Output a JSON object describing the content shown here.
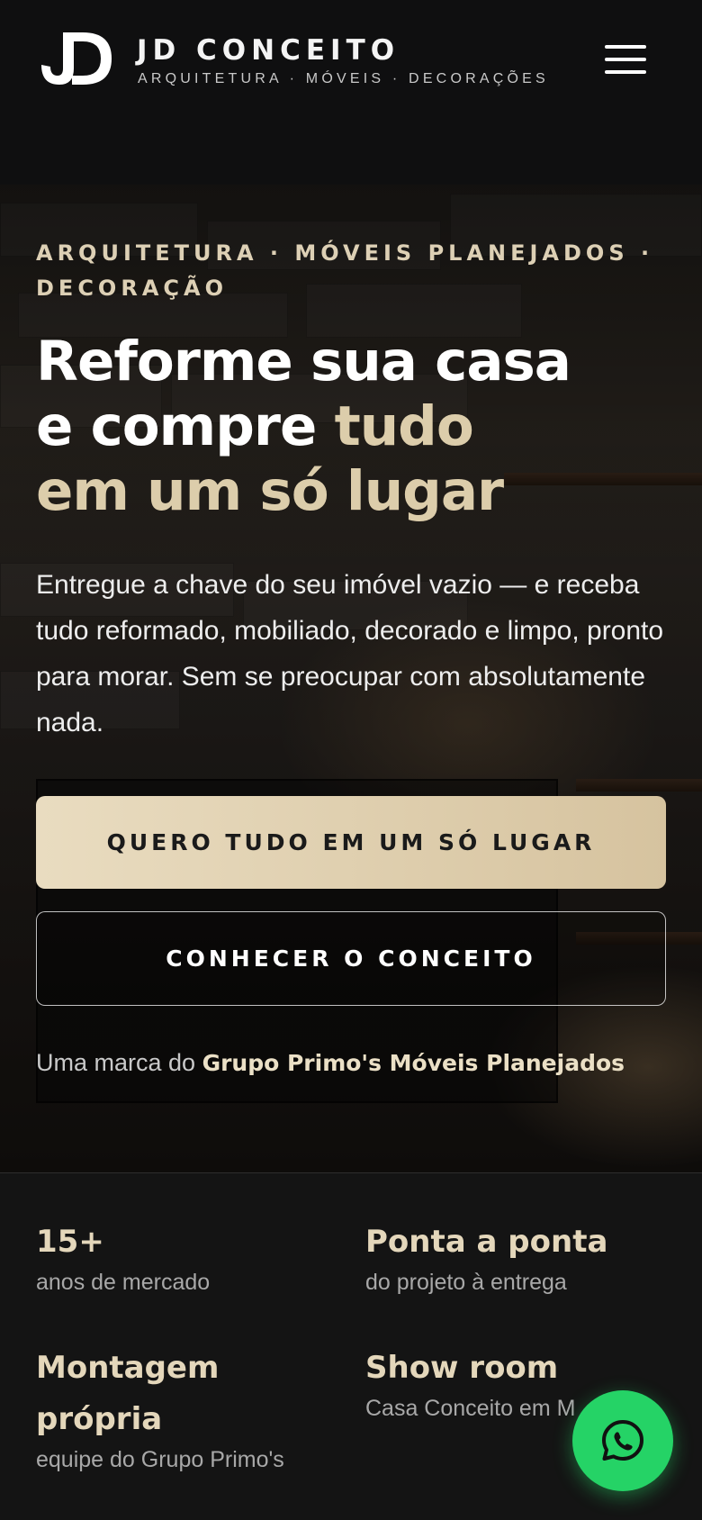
{
  "header": {
    "logo_monogram": "JD",
    "brand_name": "JD CONCEITO",
    "brand_tagline": "ARQUITETURA · MÓVEIS · DECORAÇÕES",
    "menu_icon": "hamburger-menu-icon"
  },
  "hero": {
    "eyebrow": "ARQUITETURA · MÓVEIS PLANEJADOS · DECORAÇÃO",
    "headline_line1": "Reforme sua casa",
    "headline_line2_white": "e compre ",
    "headline_line2_gold": "tudo",
    "headline_line3_gold": "em um só lugar",
    "lead": "Entregue a chave do seu imóvel vazio — e receba tudo reformado, mobiliado, decorado e limpo, pronto para morar. Sem se preocupar com absolutamente nada.",
    "primary_cta": "QUERO TUDO EM UM SÓ LUGAR",
    "secondary_cta": "CONHECER O CONCEITO",
    "byline_prefix": "Uma marca do ",
    "byline_brand": "Grupo Primo's Móveis Planejados"
  },
  "stats": [
    {
      "value": "15+",
      "label": "anos de mercado"
    },
    {
      "value": "Ponta a ponta",
      "label": "do projeto à entrega"
    },
    {
      "value": "Montagem própria",
      "label": "equipe do Grupo Primo's"
    },
    {
      "value": "Show room",
      "label": "Casa Conceito em M"
    }
  ],
  "whatsapp": {
    "icon": "whatsapp-icon"
  },
  "colors": {
    "accent_gold": "#dccdab",
    "button_gold": "#e3d5b7",
    "whatsapp_green": "#25d366",
    "background": "#121212"
  }
}
